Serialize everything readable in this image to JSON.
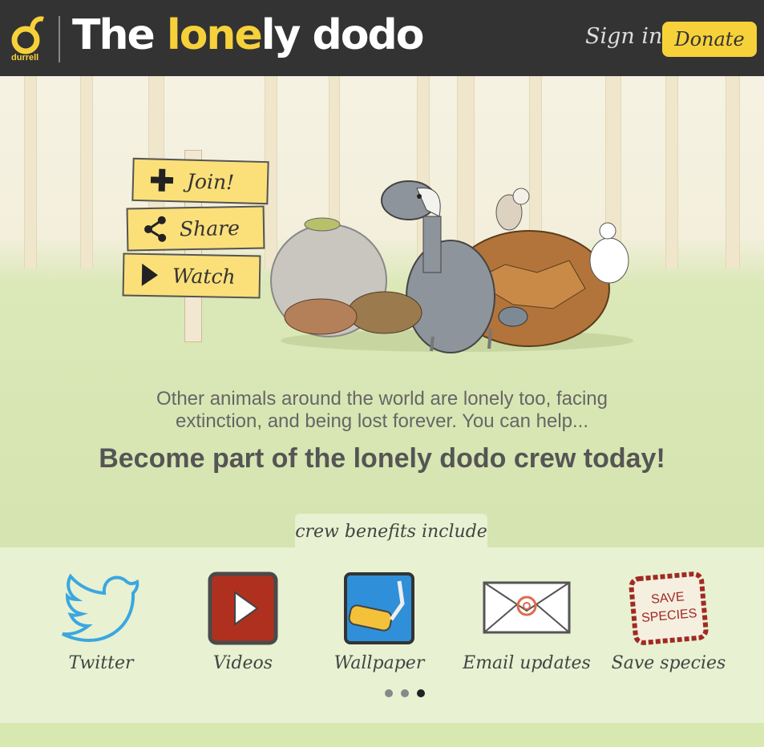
{
  "header": {
    "logo_text": "durrell",
    "title_parts": [
      "The ",
      "lone",
      "ly ",
      "dodo"
    ],
    "signin_label": "Sign in",
    "donate_label": "Donate"
  },
  "signs": [
    {
      "label": "Join!",
      "icon": "plus-icon"
    },
    {
      "label": "Share",
      "icon": "share-icon"
    },
    {
      "label": "Watch",
      "icon": "play-icon"
    }
  ],
  "intro": {
    "line1": "Other animals around the world are lonely too, facing",
    "line2": "extinction, and being lost forever. You can help...",
    "headline": "Become part of the lonely dodo crew today!"
  },
  "benefits": {
    "tab_label": "crew benefits include",
    "items": [
      {
        "label": "Twitter",
        "icon": "twitter-bird-icon"
      },
      {
        "label": "Videos",
        "icon": "video-play-icon"
      },
      {
        "label": "Wallpaper",
        "icon": "paint-roller-icon"
      },
      {
        "label": "Email updates",
        "icon": "envelope-icon"
      },
      {
        "label": "Save species",
        "icon": "save-species-stamp-icon",
        "stamp_text": [
          "SAVE",
          "SPECIES"
        ]
      }
    ],
    "pager": {
      "total": 3,
      "active": 3
    }
  },
  "colors": {
    "accent": "#f7d13a",
    "header_bg": "#333333",
    "twitter": "#3aa7e0",
    "video_red": "#b0301f",
    "stamp_red": "#a02a22"
  }
}
